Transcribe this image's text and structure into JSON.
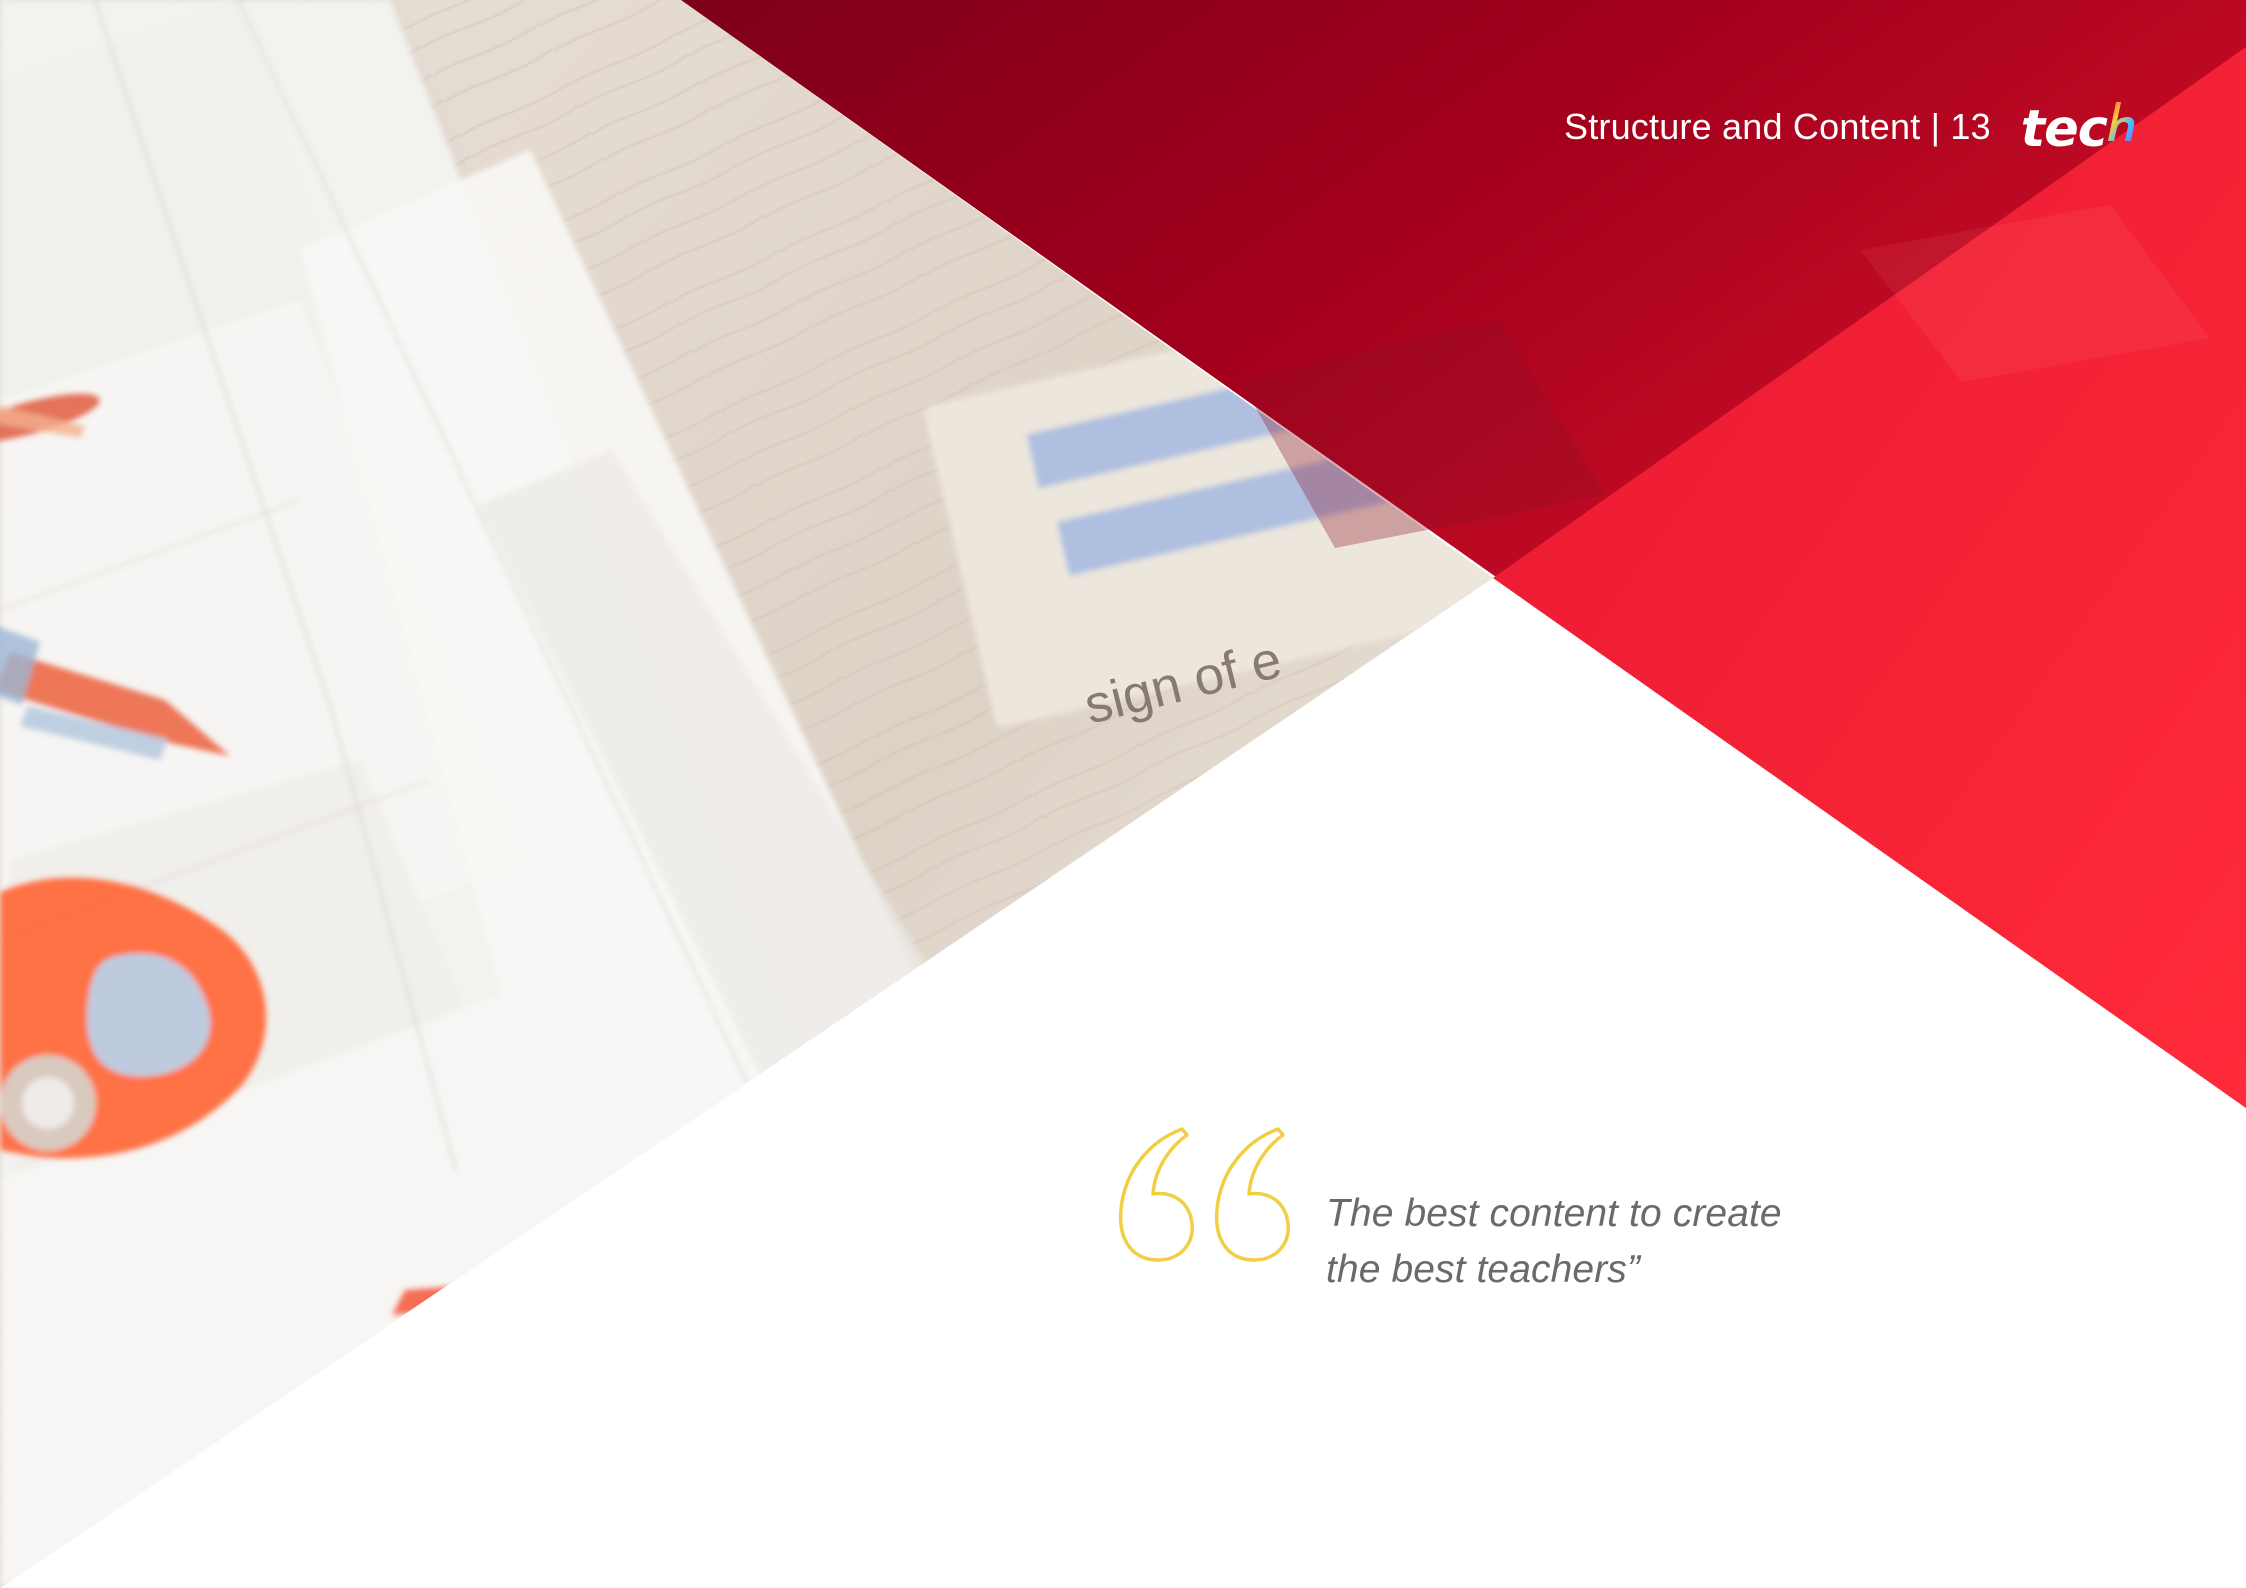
{
  "header": {
    "section_title": "Structure and Content | 13",
    "logo_text": "tec",
    "logo_last_letter": "h"
  },
  "quote": {
    "line_1": "The best content to create",
    "line_2": "the best teachers”"
  },
  "photo": {
    "visible_text": "sign of e"
  },
  "colors": {
    "dark_red": "#8f001f",
    "red": "#f3263b",
    "quote_yellow": "#f0cf44",
    "logo_h_gradient": [
      "#ff4458",
      "#ffca3a",
      "#41c1ff",
      "#7d6bff"
    ]
  },
  "icons": {
    "quote_mark": "quote-open-icon",
    "brand": "tech-logo"
  }
}
